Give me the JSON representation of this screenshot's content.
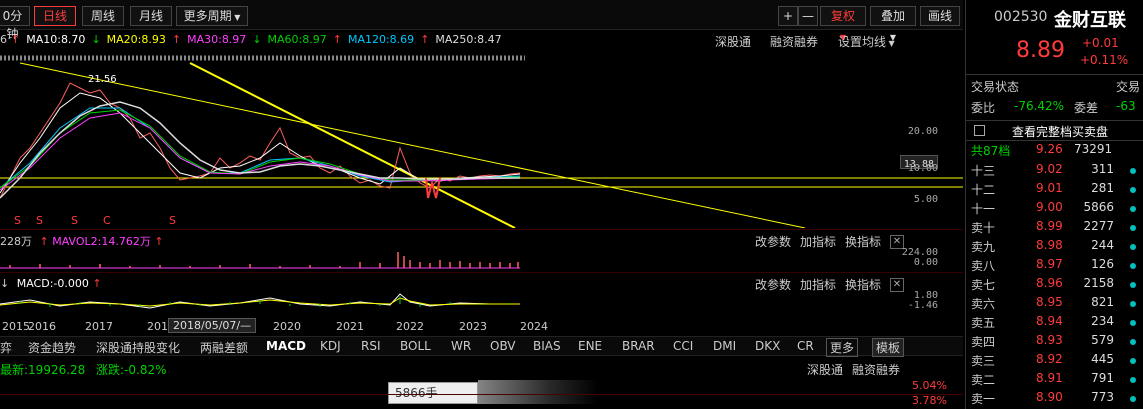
{
  "toolbar": {
    "left_cut": "0分钟",
    "day": "日线",
    "week": "周线",
    "month": "月线",
    "more_period": "更多周期",
    "plus": "+",
    "minus": "—",
    "fq": "复权",
    "overlay": "叠加",
    "draw": "画线"
  },
  "ma": {
    "cut": "6",
    "ma10": "MA10:8.70",
    "ma20": "MA20:8.93",
    "ma30": "MA30:8.97",
    "ma60": "MA60:8.97",
    "ma120": "MA120:8.69",
    "ma250": "MA250:8.47"
  },
  "links": {
    "sgt": "深股通",
    "rzrq": "融资融券",
    "settings": "设置均线"
  },
  "main_axis": {
    "high_label": "21.56",
    "ticks": [
      "20.00",
      "13.88",
      "10.00",
      "5.00"
    ]
  },
  "vol": {
    "left": "228万",
    "mavol2": "MAVOL2:14.762万",
    "params": "改参数",
    "add": "加指标",
    "switch": "换指标",
    "ticks": [
      "224.00",
      "0.00"
    ]
  },
  "macd": {
    "label": "MACD:-0.000",
    "params": "改参数",
    "add": "加指标",
    "switch": "换指标",
    "ticks": [
      "1.80",
      "-1.46"
    ]
  },
  "years": [
    "2015",
    "2016",
    "2017",
    "201",
    "2020",
    "2021",
    "2022",
    "2023",
    "2024"
  ],
  "date_box": "2018/05/07/—",
  "indicator_tabs": [
    "弈",
    "资金趋势",
    "深股通持股变化",
    "两融差额",
    "MACD",
    "KDJ",
    "RSI",
    "BOLL",
    "WR",
    "OBV",
    "BIAS",
    "ENE",
    "BRAR",
    "CCI",
    "DMI",
    "DKX",
    "CR",
    "更多",
    "模板"
  ],
  "bottom": {
    "index": "最新:19926.28",
    "change": "涨跌:-0.82%",
    "lot": "5866手",
    "sgt": "深股通",
    "rzrq": "融资融券",
    "pct1": "5.04%",
    "pct2": "3.78%"
  },
  "quote": {
    "code": "002530",
    "name": "金财互联",
    "price": "8.89",
    "change": "+0.01",
    "change_pct": "+0.11%",
    "trade_status": "交易状态",
    "trade_cut": "交易",
    "wb_label": "委比",
    "wb_value": "-76.42%",
    "wc_label": "委差",
    "wc_value": "-63",
    "full_book": "查看完整档买卖盘",
    "total_label": "共87档",
    "total_price": "9.26",
    "total_vol": "73291"
  },
  "orderbook": [
    {
      "label": "十三",
      "price": "9.02",
      "vol": "311"
    },
    {
      "label": "十二",
      "price": "9.01",
      "vol": "281"
    },
    {
      "label": "十一",
      "price": "9.00",
      "vol": "5866"
    },
    {
      "label": "卖十",
      "price": "8.99",
      "vol": "2277"
    },
    {
      "label": "卖九",
      "price": "8.98",
      "vol": "244"
    },
    {
      "label": "卖八",
      "price": "8.97",
      "vol": "126"
    },
    {
      "label": "卖七",
      "price": "8.96",
      "vol": "2158"
    },
    {
      "label": "卖六",
      "price": "8.95",
      "vol": "821"
    },
    {
      "label": "卖五",
      "price": "8.94",
      "vol": "234"
    },
    {
      "label": "卖四",
      "price": "8.93",
      "vol": "579"
    },
    {
      "label": "卖三",
      "price": "8.92",
      "vol": "445"
    },
    {
      "label": "卖二",
      "price": "8.91",
      "vol": "791"
    },
    {
      "label": "卖一",
      "price": "8.90",
      "vol": "773"
    }
  ],
  "colors": {
    "up": "#ff3b3b",
    "down": "#00d000",
    "trendline": "#ffff00",
    "ma_cyan": "#00c8ff",
    "ma_magenta": "#ff40ff"
  }
}
